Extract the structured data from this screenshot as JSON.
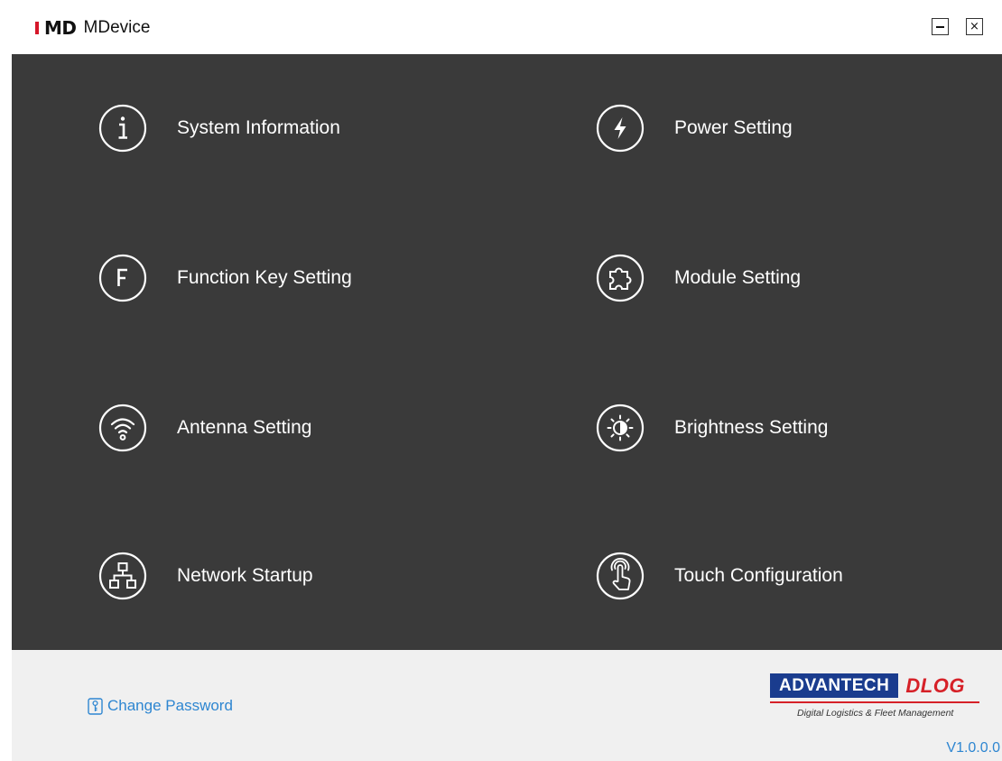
{
  "window": {
    "logo_text": "MD",
    "title": "MDevice",
    "minimize_symbol": "",
    "close_symbol": "×"
  },
  "menu": {
    "items": [
      {
        "label": "System Information",
        "icon": "info-icon"
      },
      {
        "label": "Power Setting",
        "icon": "lightning-icon"
      },
      {
        "label": "Function Key Setting",
        "icon": "function-key-icon"
      },
      {
        "label": "Module Setting",
        "icon": "puzzle-icon"
      },
      {
        "label": "Antenna Setting",
        "icon": "wifi-icon"
      },
      {
        "label": "Brightness Setting",
        "icon": "brightness-icon"
      },
      {
        "label": "Network Startup",
        "icon": "network-icon"
      },
      {
        "label": "Touch Configuration",
        "icon": "touch-icon"
      }
    ]
  },
  "footer": {
    "change_password": "Change Password",
    "brand_left": "ADVANTECH",
    "brand_right": "DLOG",
    "tagline": "Digital Logistics & Fleet Management",
    "version": "V1.0.0.0"
  },
  "colors": {
    "panel_bg": "#3a3a3a",
    "footer_bg": "#f0f0f0",
    "link_blue": "#2e86d1",
    "brand_red": "#d6172a",
    "advantech_blue": "#1a3c8e"
  }
}
